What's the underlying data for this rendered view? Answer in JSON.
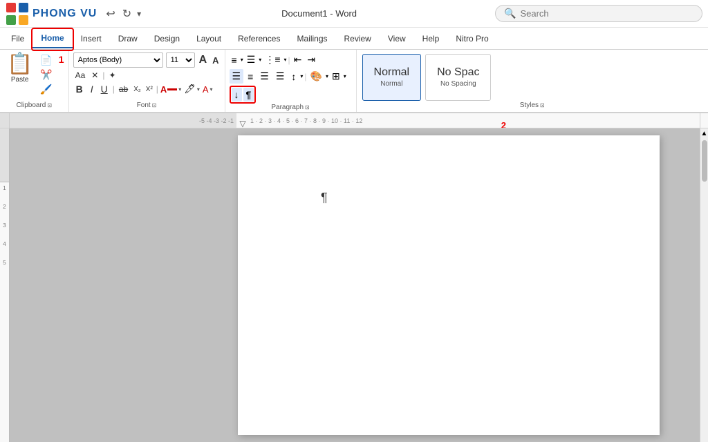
{
  "app": {
    "logo_text": "PHONG VU",
    "doc_title": "Document1 - Word",
    "search_placeholder": "Search"
  },
  "title_controls": {
    "undo": "↩",
    "redo": "↻",
    "dropdown": "▾"
  },
  "tabs": [
    {
      "id": "file",
      "label": "File",
      "active": false
    },
    {
      "id": "home",
      "label": "Home",
      "active": true
    },
    {
      "id": "insert",
      "label": "Insert",
      "active": false
    },
    {
      "id": "draw",
      "label": "Draw",
      "active": false
    },
    {
      "id": "design",
      "label": "Design",
      "active": false
    },
    {
      "id": "layout",
      "label": "Layout",
      "active": false
    },
    {
      "id": "references",
      "label": "References",
      "active": false
    },
    {
      "id": "mailings",
      "label": "Mailings",
      "active": false
    },
    {
      "id": "review",
      "label": "Review",
      "active": false
    },
    {
      "id": "view",
      "label": "View",
      "active": false
    },
    {
      "id": "help",
      "label": "Help",
      "active": false
    },
    {
      "id": "nitro",
      "label": "Nitro Pro",
      "active": false
    }
  ],
  "ribbon": {
    "clipboard": {
      "label": "Clipboard",
      "paste_label": "Paste",
      "buttons": [
        "📋",
        "📄",
        "✂️",
        "🖌️"
      ]
    },
    "font": {
      "label": "Font",
      "font_name": "Aptos (Body)",
      "font_size": "11",
      "buttons": {
        "grow": "A",
        "shrink": "A",
        "bold": "B",
        "italic": "I",
        "underline": "U",
        "strikethrough": "ab",
        "subscript": "X₂",
        "superscript": "X²"
      }
    },
    "paragraph": {
      "label": "Paragraph",
      "show_marks_label": "¶",
      "sort_label": "↓"
    },
    "styles": {
      "label": "Styles",
      "items": [
        {
          "name": "Normal",
          "active": true
        },
        {
          "name": "No Spac",
          "active": false
        }
      ]
    }
  },
  "annotation": {
    "badge1": "1",
    "badge2": "2"
  },
  "ruler": {
    "marks": [
      "-5",
      "-4",
      "-3",
      "-2",
      "-1",
      "1",
      "2",
      "3",
      "4",
      "5",
      "6",
      "7",
      "8",
      "9",
      "10",
      "11",
      "12"
    ]
  }
}
